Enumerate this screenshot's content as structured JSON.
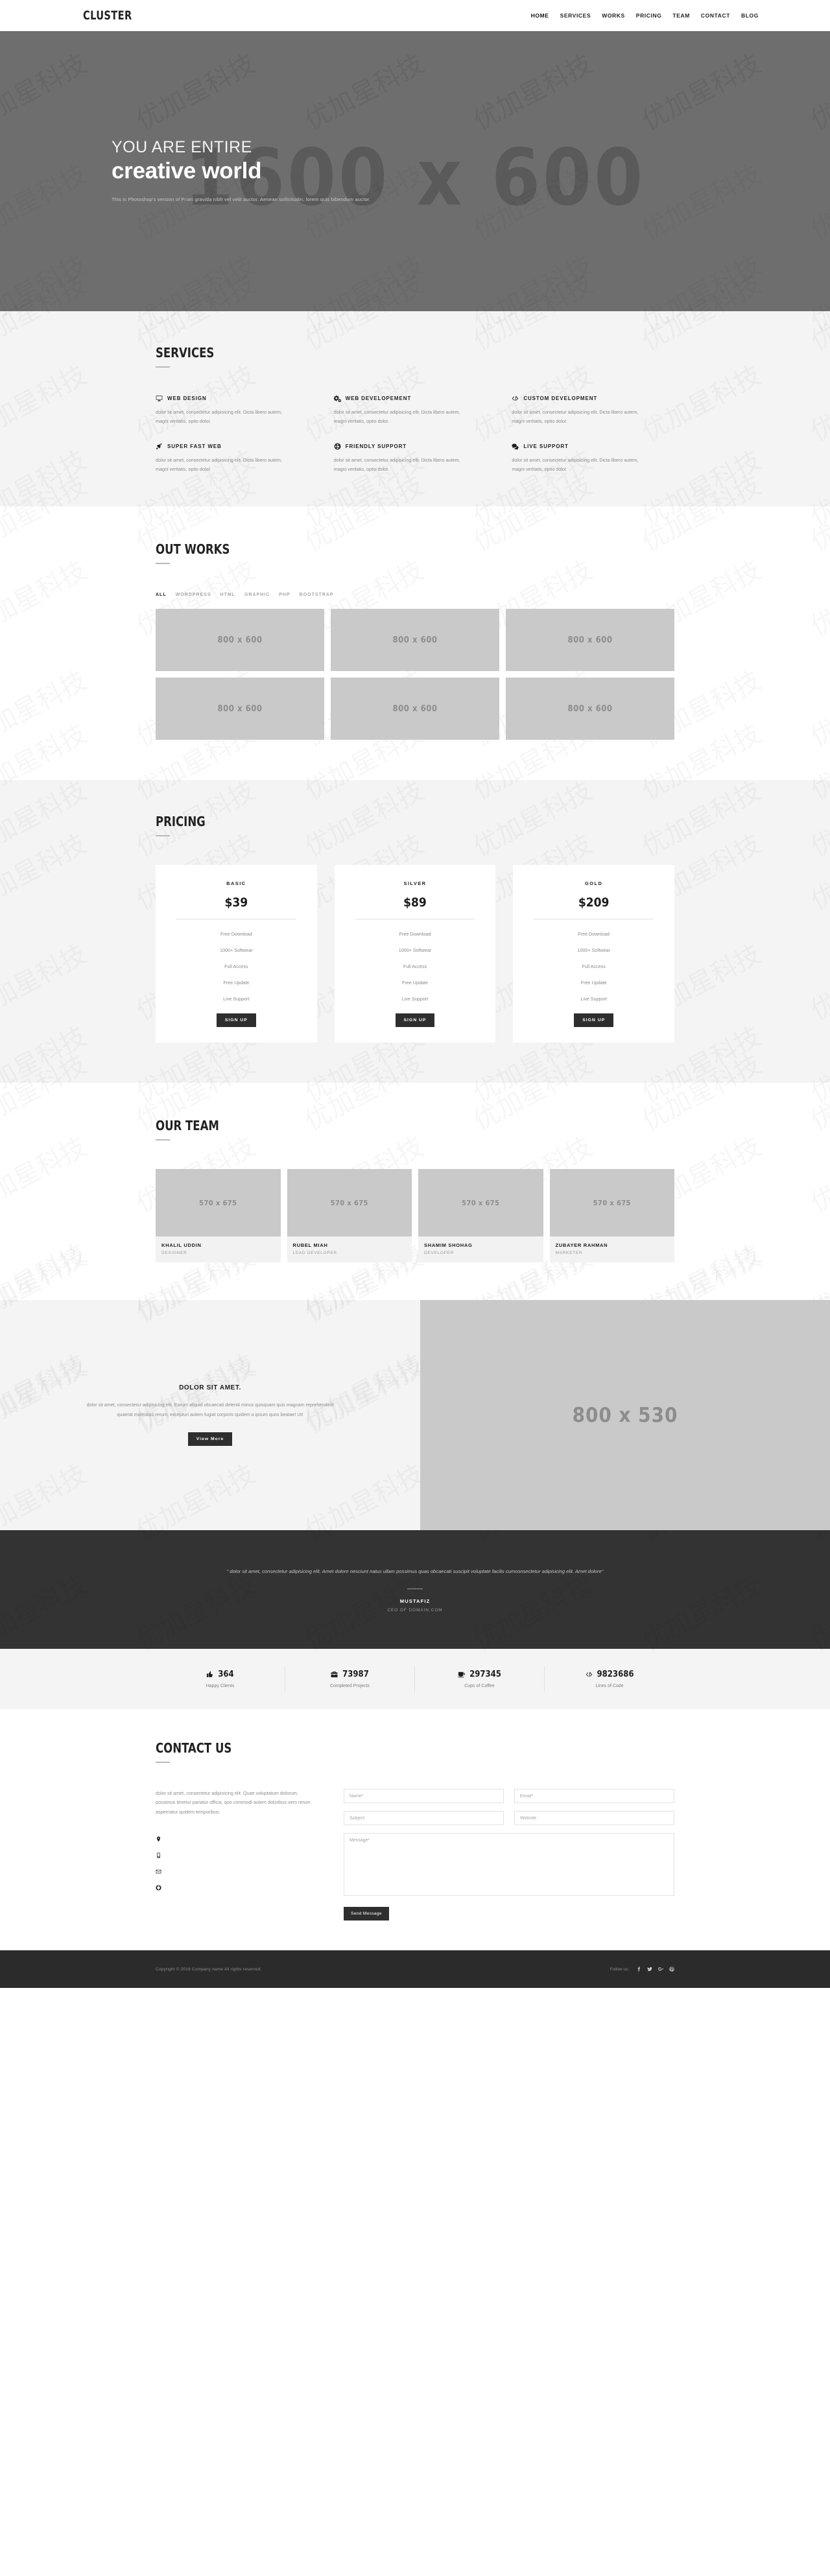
{
  "colors": {
    "hero_bg": "#6e6e6e",
    "placeholder": "#c9c9c9",
    "dark": "#2b2b2b",
    "testimonial_bg": "#333333",
    "section_gray": "#f4f4f4",
    "accent_text": "#222222"
  },
  "header": {
    "brand": "CLUSTER",
    "nav": [
      {
        "label": "HOME"
      },
      {
        "label": "SERVICES"
      },
      {
        "label": "WORKS"
      },
      {
        "label": "PRICING"
      },
      {
        "label": "TEAM"
      },
      {
        "label": "CONTACT"
      },
      {
        "label": "BLOG"
      }
    ]
  },
  "hero": {
    "placeholder": "1600 x 600",
    "subtitle": "YOU ARE ENTIRE",
    "title": "creative world",
    "text": "This is Photoshop's version of  Proin gravida nibh vel velit auctor. Aenean sollicitudin, lorem quis bibendum auctor."
  },
  "services": {
    "title": "SERVICES",
    "items": [
      {
        "icon": "desktop-icon",
        "title": "WEB DESIGN",
        "text": "dolor sit amet, consectetur adipisicing elit. Dicta libero autem, magni veritatis, optio dolor."
      },
      {
        "icon": "cogs-icon",
        "title": "WEB DEVELOPEMENT",
        "text": "dolor sit amet, consectetur adipisicing elit. Dicta libero autem, magni veritatis, optio dolor."
      },
      {
        "icon": "code-icon",
        "title": "CUSTOM DEVELOPMENT",
        "text": "dolor sit amet, consectetur adipisicing elit. Dicta libero autem, magni veritatis, optio dolor."
      },
      {
        "icon": "rocket-icon",
        "title": "SUPER FAST WEB",
        "text": "dolor sit amet, consectetur adipisicing elit. Dicta libero autem, magni veritatis, optio dolor."
      },
      {
        "icon": "lifebuoy-icon",
        "title": "FRIENDLY SUPPORT",
        "text": "dolor sit amet, consectetur adipisicing elit. Dicta libero autem, magni veritatis, optio dolor."
      },
      {
        "icon": "comments-icon",
        "title": "LIVE SUPPORT",
        "text": "dolor sit amet, consectetur adipisicing elit. Dicta libero autem, magni veritatis, optio dolor."
      }
    ]
  },
  "works": {
    "title": "OUT WORKS",
    "filters": [
      {
        "label": "ALL",
        "active": true
      },
      {
        "label": "WORDPRESS",
        "active": false
      },
      {
        "label": "HTML",
        "active": false
      },
      {
        "label": "GRAPHIC",
        "active": false
      },
      {
        "label": "PHP",
        "active": false
      },
      {
        "label": "BOOTSTRAP",
        "active": false
      }
    ],
    "items": [
      {
        "placeholder": "800 x 600"
      },
      {
        "placeholder": "800 x 600"
      },
      {
        "placeholder": "800 x 600"
      },
      {
        "placeholder": "800 x 600"
      },
      {
        "placeholder": "800 x 600"
      },
      {
        "placeholder": "800 x 600"
      }
    ]
  },
  "pricing": {
    "title": "PRICING",
    "plans": [
      {
        "name": "BASIC",
        "price": "$39",
        "features": [
          "Free Download",
          "1000+ Softwear",
          "Full Access",
          "Free Update",
          "Live Support"
        ],
        "cta": "SIGN UP"
      },
      {
        "name": "SILVER",
        "price": "$89",
        "features": [
          "Free Download",
          "1000+ Softwear",
          "Full Access",
          "Free Update",
          "Live Support"
        ],
        "cta": "SIGN UP"
      },
      {
        "name": "GOLD",
        "price": "$209",
        "features": [
          "Free Download",
          "1000+ Softwear",
          "Full Access",
          "Free Update",
          "Live Support"
        ],
        "cta": "SIGN UP"
      }
    ]
  },
  "team": {
    "title": "OUR TEAM",
    "members": [
      {
        "placeholder": "570 x 675",
        "name": "KHALIL UDDIN",
        "role": "DESIGNER"
      },
      {
        "placeholder": "570 x 675",
        "name": "RUBEL MIAH",
        "role": "LEAD DEVELOPER"
      },
      {
        "placeholder": "570 x 675",
        "name": "SHAMIM SHOHAG",
        "role": "DEVELOPER"
      },
      {
        "placeholder": "570 x 675",
        "name": "ZUBAYER RAHMAN",
        "role": "MARKETER"
      }
    ]
  },
  "about": {
    "title": "DOLOR SIT AMET.",
    "text": "dolor sit amet, consectetur adipisicing elit. Earum aliquid obcaecati deleniti minus quisquam quis magnam reprehenderit quaerat molestias rerum, excepturi autem fugiat corporis quidem a ipsum quos beatae! Ut!",
    "button": "View More",
    "placeholder": "800 x 530"
  },
  "testimonial": {
    "quote": "\" dolor sit amet, consectetur adipisicing elit. Amet dolore nesciunt natus ullam possimus quas obcaecati suscipit voluptate facilis cumconsectetur adipisicing elit. Amet dolore\"",
    "name": "MUSTAFIZ",
    "role": "CEO OF DOMAIN.COM"
  },
  "counters": [
    {
      "icon": "thumbs-up-icon",
      "value": "364",
      "label": "Happy Clients"
    },
    {
      "icon": "briefcase-icon",
      "value": "73987",
      "label": "Completed Projects"
    },
    {
      "icon": "coffee-icon",
      "value": "297345",
      "label": "Cups of Coffee"
    },
    {
      "icon": "code-icon",
      "value": "9823686",
      "label": "Lines of Code"
    }
  ],
  "contact": {
    "title": "CONTACT US",
    "description": "dolor sit amet, consectetur adipisicing elit. Quae voluptatum dolorum, possimus tenetur pariatur officia, quo commodi autem doloribus vero rerum aspernatur quidem temporibus.",
    "info": [
      {
        "icon": "map-marker-icon",
        "value": ""
      },
      {
        "icon": "mobile-icon",
        "value": ""
      },
      {
        "icon": "envelope-icon",
        "value": ""
      },
      {
        "icon": "globe-icon",
        "value": ""
      }
    ],
    "form": {
      "name_placeholder": "Name*",
      "email_placeholder": "Email*",
      "subject_placeholder": "Subject",
      "website_placeholder": "Website",
      "message_placeholder": "Message*",
      "submit": "Send Message"
    }
  },
  "footer": {
    "copyright": "Copyright © 2016 Company name All rights reserved.",
    "follow_label": "Follow us:",
    "social": [
      {
        "icon": "facebook-icon"
      },
      {
        "icon": "twitter-icon"
      },
      {
        "icon": "google-plus-icon"
      },
      {
        "icon": "pinterest-icon"
      }
    ]
  }
}
